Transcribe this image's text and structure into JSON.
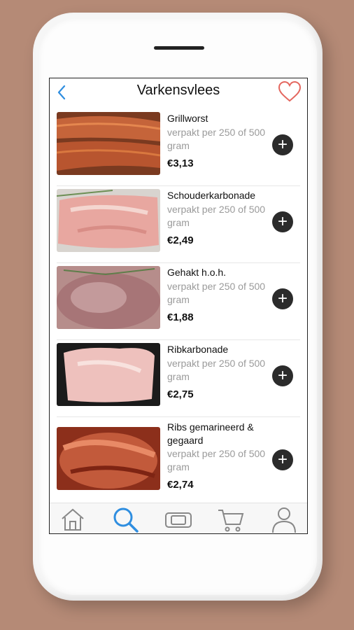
{
  "nav": {
    "title": "Varkensvlees"
  },
  "items": [
    {
      "name": "Grillworst",
      "subtitle": "verpakt per 250 of 500 gram",
      "price": "€3,13"
    },
    {
      "name": "Schouderkarbonade",
      "subtitle": "verpakt per 250 of 500 gram",
      "price": "€2,49"
    },
    {
      "name": "Gehakt h.o.h.",
      "subtitle": "verpakt per 250 of 500 gram",
      "price": "€1,88"
    },
    {
      "name": "Ribkarbonade",
      "subtitle": "verpakt per 250 of 500 gram",
      "price": "€2,75"
    },
    {
      "name": "Ribs gemarineerd & gegaard",
      "subtitle": "verpakt per 250 of 500 gram",
      "price": "€2,74"
    }
  ],
  "colors": {
    "accent": "#2f8ee0",
    "heart": "#e4675f",
    "background": "#b58a76"
  },
  "tabs": [
    "home-icon",
    "search-icon",
    "ticket-icon",
    "cart-icon",
    "profile-icon"
  ]
}
